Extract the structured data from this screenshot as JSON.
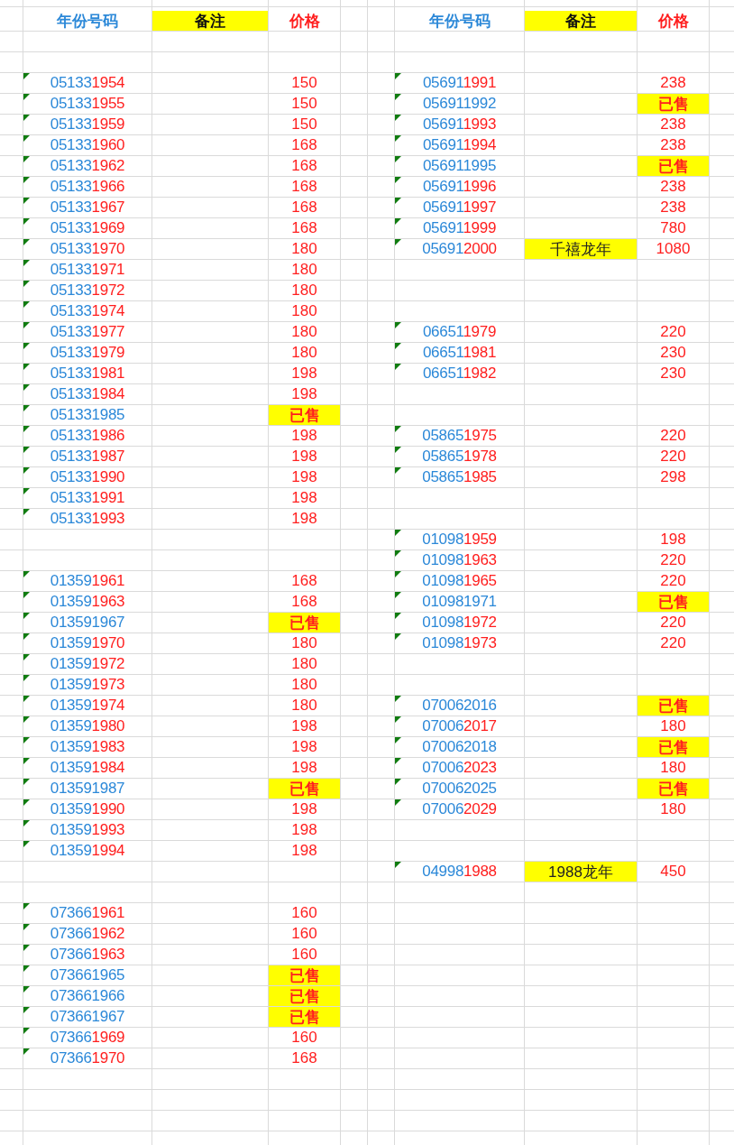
{
  "left_header": {
    "code": "年份号码",
    "note": "备注",
    "price": "价格"
  },
  "right_header": {
    "code": "年份号码",
    "note": "备注",
    "price": "价格"
  },
  "rows": [
    {},
    {},
    {
      "left": {
        "code": "051331954",
        "price": "150",
        "sold": false
      },
      "right": {
        "code": "056911991",
        "price": "238",
        "sold": false
      }
    },
    {
      "left": {
        "code": "051331955",
        "price": "150",
        "sold": false
      },
      "right": {
        "code": "056911992",
        "price": "已售",
        "sold": true
      }
    },
    {
      "left": {
        "code": "051331959",
        "price": "150",
        "sold": false
      },
      "right": {
        "code": "056911993",
        "price": "238",
        "sold": false
      }
    },
    {
      "left": {
        "code": "051331960",
        "price": "168",
        "sold": false
      },
      "right": {
        "code": "056911994",
        "price": "238",
        "sold": false
      }
    },
    {
      "left": {
        "code": "051331962",
        "price": "168",
        "sold": false
      },
      "right": {
        "code": "056911995",
        "price": "已售",
        "sold": true
      }
    },
    {
      "left": {
        "code": "051331966",
        "price": "168",
        "sold": false
      },
      "right": {
        "code": "056911996",
        "price": "238",
        "sold": false
      }
    },
    {
      "left": {
        "code": "051331967",
        "price": "168",
        "sold": false
      },
      "right": {
        "code": "056911997",
        "price": "238",
        "sold": false
      }
    },
    {
      "left": {
        "code": "051331969",
        "price": "168",
        "sold": false
      },
      "right": {
        "code": "056911999",
        "price": "780",
        "sold": false
      }
    },
    {
      "left": {
        "code": "051331970",
        "price": "180",
        "sold": false
      },
      "right": {
        "code": "056912000",
        "note": "千禧龙年",
        "price": "1080",
        "sold": false
      }
    },
    {
      "left": {
        "code": "051331971",
        "price": "180",
        "sold": false
      }
    },
    {
      "left": {
        "code": "051331972",
        "price": "180",
        "sold": false
      }
    },
    {
      "left": {
        "code": "051331974",
        "price": "180",
        "sold": false
      }
    },
    {
      "left": {
        "code": "051331977",
        "price": "180",
        "sold": false
      },
      "right": {
        "code": "066511979",
        "price": "220",
        "sold": false
      }
    },
    {
      "left": {
        "code": "051331979",
        "price": "180",
        "sold": false
      },
      "right": {
        "code": "066511981",
        "price": "230",
        "sold": false
      }
    },
    {
      "left": {
        "code": "051331981",
        "price": "198",
        "sold": false
      },
      "right": {
        "code": "066511982",
        "price": "230",
        "sold": false
      }
    },
    {
      "left": {
        "code": "051331984",
        "price": "198",
        "sold": false
      }
    },
    {
      "left": {
        "code": "051331985",
        "price": "已售",
        "sold": true
      }
    },
    {
      "left": {
        "code": "051331986",
        "price": "198",
        "sold": false
      },
      "right": {
        "code": "058651975",
        "price": "220",
        "sold": false
      }
    },
    {
      "left": {
        "code": "051331987",
        "price": "198",
        "sold": false
      },
      "right": {
        "code": "058651978",
        "price": "220",
        "sold": false
      }
    },
    {
      "left": {
        "code": "051331990",
        "price": "198",
        "sold": false
      },
      "right": {
        "code": "058651985",
        "price": "298",
        "sold": false
      }
    },
    {
      "left": {
        "code": "051331991",
        "price": "198",
        "sold": false
      }
    },
    {
      "left": {
        "code": "051331993",
        "price": "198",
        "sold": false
      }
    },
    {
      "right": {
        "code": "010981959",
        "price": "198",
        "sold": false
      }
    },
    {
      "right": {
        "code": "010981963",
        "price": "220",
        "sold": false
      }
    },
    {
      "left": {
        "code": "013591961",
        "price": "168",
        "sold": false
      },
      "right": {
        "code": "010981965",
        "price": "220",
        "sold": false
      }
    },
    {
      "left": {
        "code": "013591963",
        "price": "168",
        "sold": false
      },
      "right": {
        "code": "010981971",
        "price": "已售",
        "sold": true
      }
    },
    {
      "left": {
        "code": "013591967",
        "price": "已售",
        "sold": true
      },
      "right": {
        "code": "010981972",
        "price": "220",
        "sold": false
      }
    },
    {
      "left": {
        "code": "013591970",
        "price": "180",
        "sold": false
      },
      "right": {
        "code": "010981973",
        "price": "220",
        "sold": false
      }
    },
    {
      "left": {
        "code": "013591972",
        "price": "180",
        "sold": false
      }
    },
    {
      "left": {
        "code": "013591973",
        "price": "180",
        "sold": false
      }
    },
    {
      "left": {
        "code": "013591974",
        "price": "180",
        "sold": false
      },
      "right": {
        "code": "070062016",
        "price": "已售",
        "sold": true
      }
    },
    {
      "left": {
        "code": "013591980",
        "price": "198",
        "sold": false
      },
      "right": {
        "code": "070062017",
        "price": "180",
        "sold": false
      }
    },
    {
      "left": {
        "code": "013591983",
        "price": "198",
        "sold": false
      },
      "right": {
        "code": "070062018",
        "price": "已售",
        "sold": true
      }
    },
    {
      "left": {
        "code": "013591984",
        "price": "198",
        "sold": false
      },
      "right": {
        "code": "070062023",
        "price": "180",
        "sold": false
      }
    },
    {
      "left": {
        "code": "013591987",
        "price": "已售",
        "sold": true
      },
      "right": {
        "code": "070062025",
        "price": "已售",
        "sold": true
      }
    },
    {
      "left": {
        "code": "013591990",
        "price": "198",
        "sold": false
      },
      "right": {
        "code": "070062029",
        "price": "180",
        "sold": false
      }
    },
    {
      "left": {
        "code": "013591993",
        "price": "198",
        "sold": false
      }
    },
    {
      "left": {
        "code": "013591994",
        "price": "198",
        "sold": false
      }
    },
    {
      "right": {
        "code": "049981988",
        "note": "1988龙年",
        "price": "450",
        "sold": false
      }
    },
    {},
    {
      "left": {
        "code": "073661961",
        "price": "160",
        "sold": false
      }
    },
    {
      "left": {
        "code": "073661962",
        "price": "160",
        "sold": false
      }
    },
    {
      "left": {
        "code": "073661963",
        "price": "160",
        "sold": false
      }
    },
    {
      "left": {
        "code": "073661965",
        "price": "已售",
        "sold": true
      }
    },
    {
      "left": {
        "code": "073661966",
        "price": "已售",
        "sold": true
      }
    },
    {
      "left": {
        "code": "073661967",
        "price": "已售",
        "sold": true
      }
    },
    {
      "left": {
        "code": "073661969",
        "price": "160",
        "sold": false
      }
    },
    {
      "left": {
        "code": "073661970",
        "price": "168",
        "sold": false
      }
    }
  ]
}
